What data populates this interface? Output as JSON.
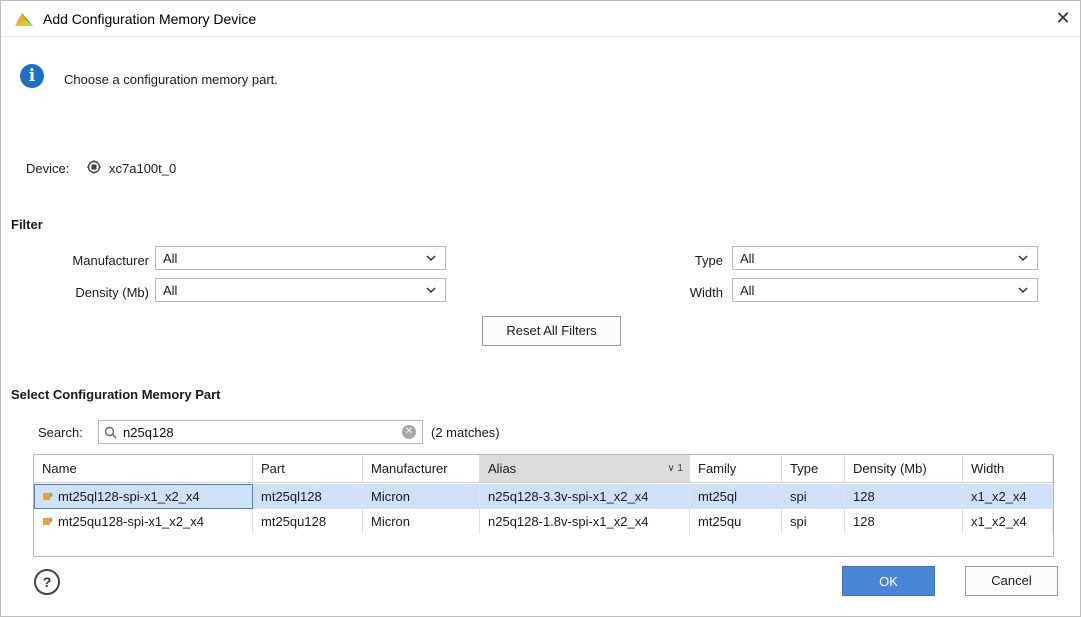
{
  "window": {
    "title": "Add Configuration Memory Device"
  },
  "info": {
    "message": "Choose a configuration memory part."
  },
  "device": {
    "label": "Device:",
    "value": "xc7a100t_0"
  },
  "filter": {
    "section_title": "Filter",
    "manufacturer": {
      "label": "Manufacturer",
      "value": "All"
    },
    "density": {
      "label": "Density (Mb)",
      "value": "All"
    },
    "type": {
      "label": "Type",
      "value": "All"
    },
    "width": {
      "label": "Width",
      "value": "All"
    },
    "reset_label": "Reset All Filters"
  },
  "select_part": {
    "section_title": "Select Configuration Memory Part",
    "search_label": "Search:",
    "search_value": "n25q128",
    "match_count": "(2 matches)"
  },
  "table": {
    "columns": [
      "Name",
      "Part",
      "Manufacturer",
      "Alias",
      "Family",
      "Type",
      "Density (Mb)",
      "Width"
    ],
    "sort_indicator": "∨ 1",
    "rows": [
      [
        "mt25ql128-spi-x1_x2_x4",
        "mt25ql128",
        "Micron",
        "n25q128-3.3v-spi-x1_x2_x4",
        "mt25ql",
        "spi",
        "128",
        "x1_x2_x4"
      ],
      [
        "mt25qu128-spi-x1_x2_x4",
        "mt25qu128",
        "Micron",
        "n25q128-1.8v-spi-x1_x2_x4",
        "mt25qu",
        "spi",
        "128",
        "x1_x2_x4"
      ]
    ]
  },
  "footer": {
    "help": "?",
    "ok_label": "OK",
    "cancel_label": "Cancel"
  },
  "colors": {
    "accent": "#4a86d4",
    "info": "#1f6fc5",
    "selection": "#cfe0f9"
  }
}
